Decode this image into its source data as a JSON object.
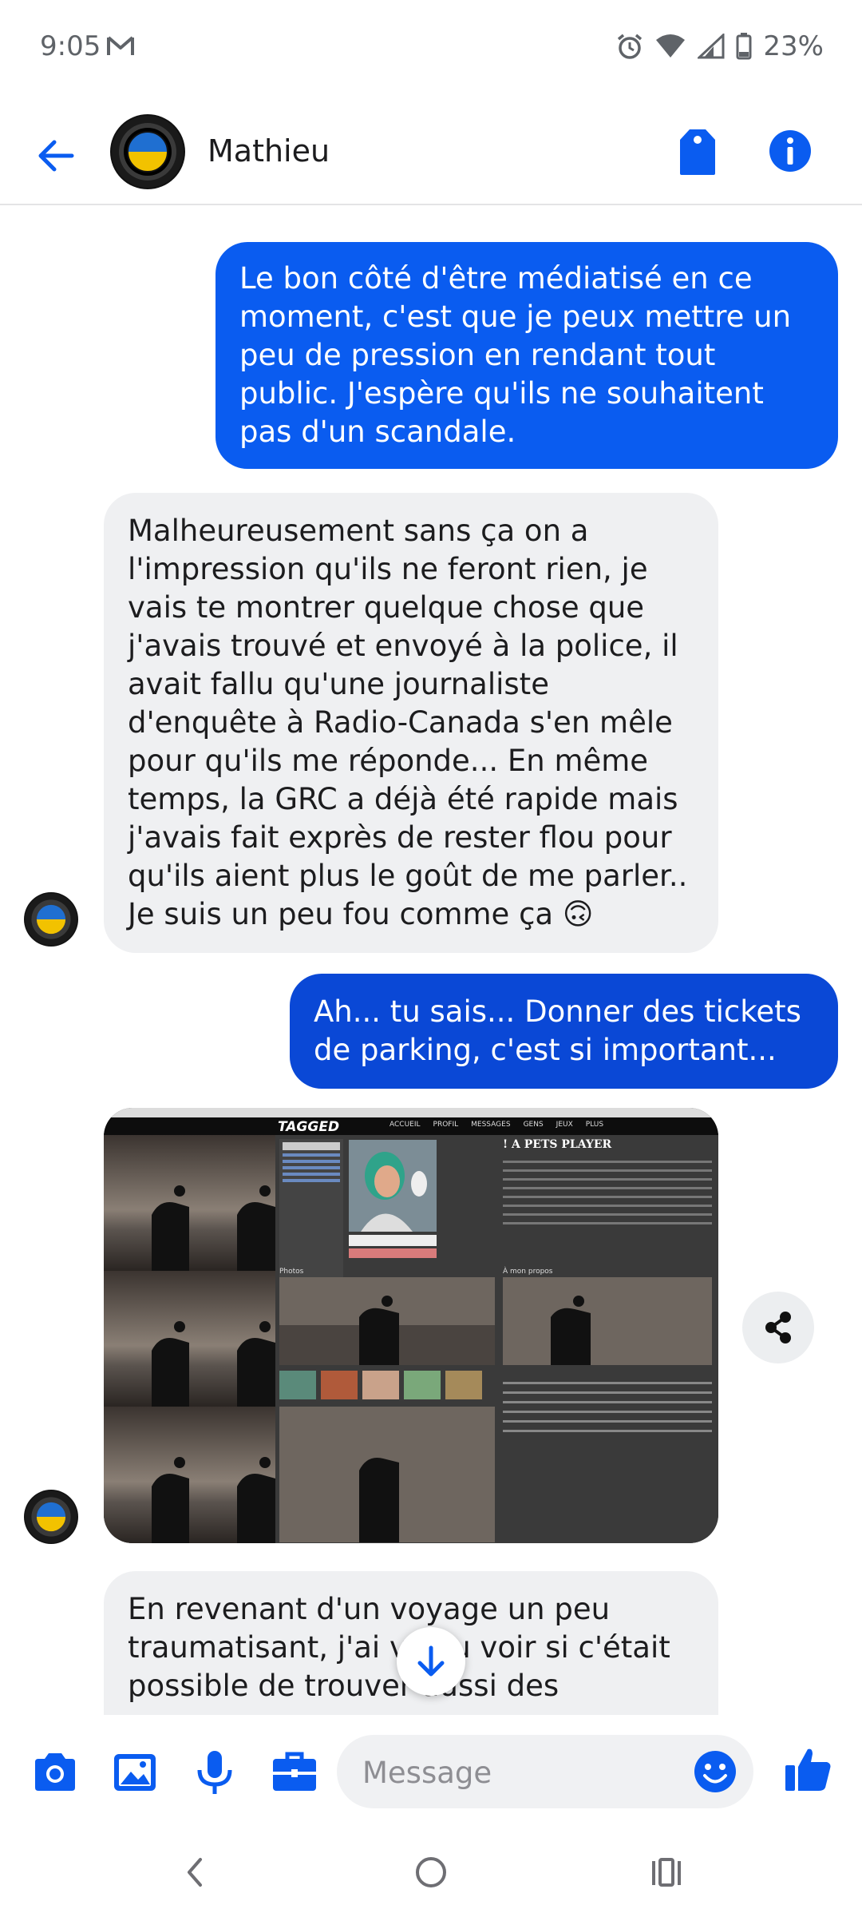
{
  "status_bar": {
    "time": "9:05",
    "battery": "23%",
    "icons": [
      "mail-icon",
      "alarm-icon",
      "wifi-icon",
      "signal-icon",
      "battery-icon"
    ]
  },
  "header": {
    "contact_name": "Mathieu",
    "icons": [
      "back-arrow-icon",
      "tag-icon",
      "info-icon"
    ],
    "accent_color": "#0a5cf0"
  },
  "messages": [
    {
      "direction": "outgoing",
      "text": "Le bon côté d'être médiatisé en ce moment, c'est que je peux mettre un peu de pression en rendant tout public. J'espère qu'ils ne souhaitent pas d'un scandale."
    },
    {
      "direction": "incoming",
      "text": "Malheureusement sans ça on a l'impression qu'ils ne feront rien, je vais te montrer quelque chose que j'avais trouvé et envoyé à la police, il avait fallu qu'une journaliste d'enquête à Radio-Canada s'en mêle pour qu'ils me réponde... En même temps, la GRC a déjà été rapide mais j'avais fait exprès de rester flou pour qu'ils aient plus le goût de me parler.. Je suis un peu fou comme ça 🙃"
    },
    {
      "direction": "outgoing",
      "text": "Ah... tu sais... Donner des tickets de parking, c'est si important..."
    },
    {
      "direction": "incoming",
      "type": "image",
      "screenshot": {
        "site_logo": "TAGGED",
        "profile_title": "! A PETS PLAYER",
        "nav_items": [
          "ACCUEIL",
          "PROFIL",
          "MESSAGES",
          "GENS",
          "JEUX",
          "PLUS"
        ],
        "section_photos": "Photos",
        "section_about": "À mon propos"
      }
    },
    {
      "direction": "incoming",
      "text": "En revenant d'un voyage un peu traumatisant, j'ai voulu voir si c'était possible de trouver aussi des"
    }
  ],
  "composer": {
    "placeholder": "Message",
    "icons": [
      "camera-icon",
      "gallery-icon",
      "microphone-icon",
      "briefcase-icon",
      "emoji-icon",
      "thumbs-up-icon"
    ]
  },
  "nav": {
    "icons": [
      "nav-back-icon",
      "nav-home-icon",
      "nav-recents-icon"
    ]
  }
}
